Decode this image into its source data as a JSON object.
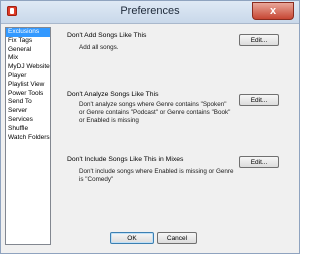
{
  "window": {
    "title": "Preferences",
    "close_label": "x"
  },
  "sidebar": {
    "items": [
      {
        "label": "Exclusions",
        "selected": true
      },
      {
        "label": "Fix Tags",
        "selected": false
      },
      {
        "label": "General",
        "selected": false
      },
      {
        "label": "Mix",
        "selected": false
      },
      {
        "label": "MyDJ Website",
        "selected": false
      },
      {
        "label": "Player",
        "selected": false
      },
      {
        "label": "Playlist View",
        "selected": false
      },
      {
        "label": "Power Tools",
        "selected": false
      },
      {
        "label": "Send To",
        "selected": false
      },
      {
        "label": "Server",
        "selected": false
      },
      {
        "label": "Services",
        "selected": false
      },
      {
        "label": "Shuffle",
        "selected": false
      },
      {
        "label": "Watch Folders",
        "selected": false
      }
    ]
  },
  "sections": [
    {
      "title": "Don't Add Songs Like This",
      "description": "Add all songs.",
      "edit_label": "Edit..."
    },
    {
      "title": "Don't Analyze Songs Like This",
      "description": "Don't analyze songs where Genre contains \"Spoken\" or Genre contains \"Podcast\" or Genre contains \"Book\" or Enabled is missing",
      "edit_label": "Edit..."
    },
    {
      "title": "Don't Include Songs Like This in Mixes",
      "description": "Don't include songs where Enabled is missing or Genre is \"Comedy\"",
      "edit_label": "Edit..."
    }
  ],
  "footer": {
    "ok_label": "OK",
    "cancel_label": "Cancel"
  }
}
